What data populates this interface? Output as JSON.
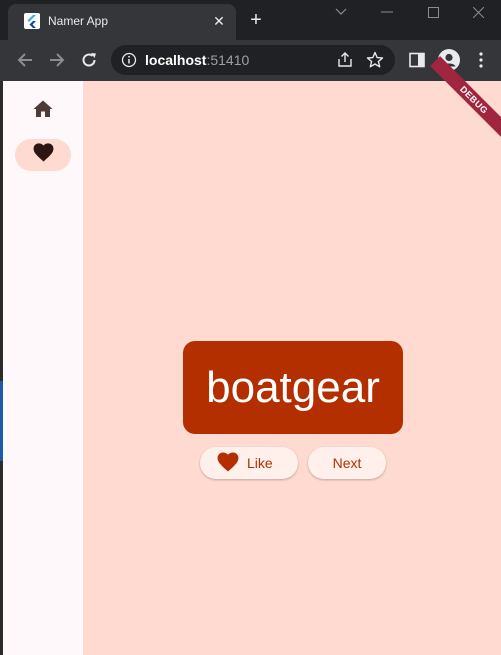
{
  "browser": {
    "tab_title": "Namer App",
    "url_host": "localhost",
    "url_port": ":51410"
  },
  "app": {
    "debug_banner": "DEBUG",
    "word": "boatgear",
    "like_label": "Like",
    "next_label": "Next",
    "nav": [
      {
        "icon": "home-icon",
        "selected": false
      },
      {
        "icon": "favorite-icon",
        "selected": true
      }
    ],
    "colors": {
      "background": "#ffdad0",
      "primary": "#b32f00",
      "rail": "#fff8fa"
    }
  }
}
